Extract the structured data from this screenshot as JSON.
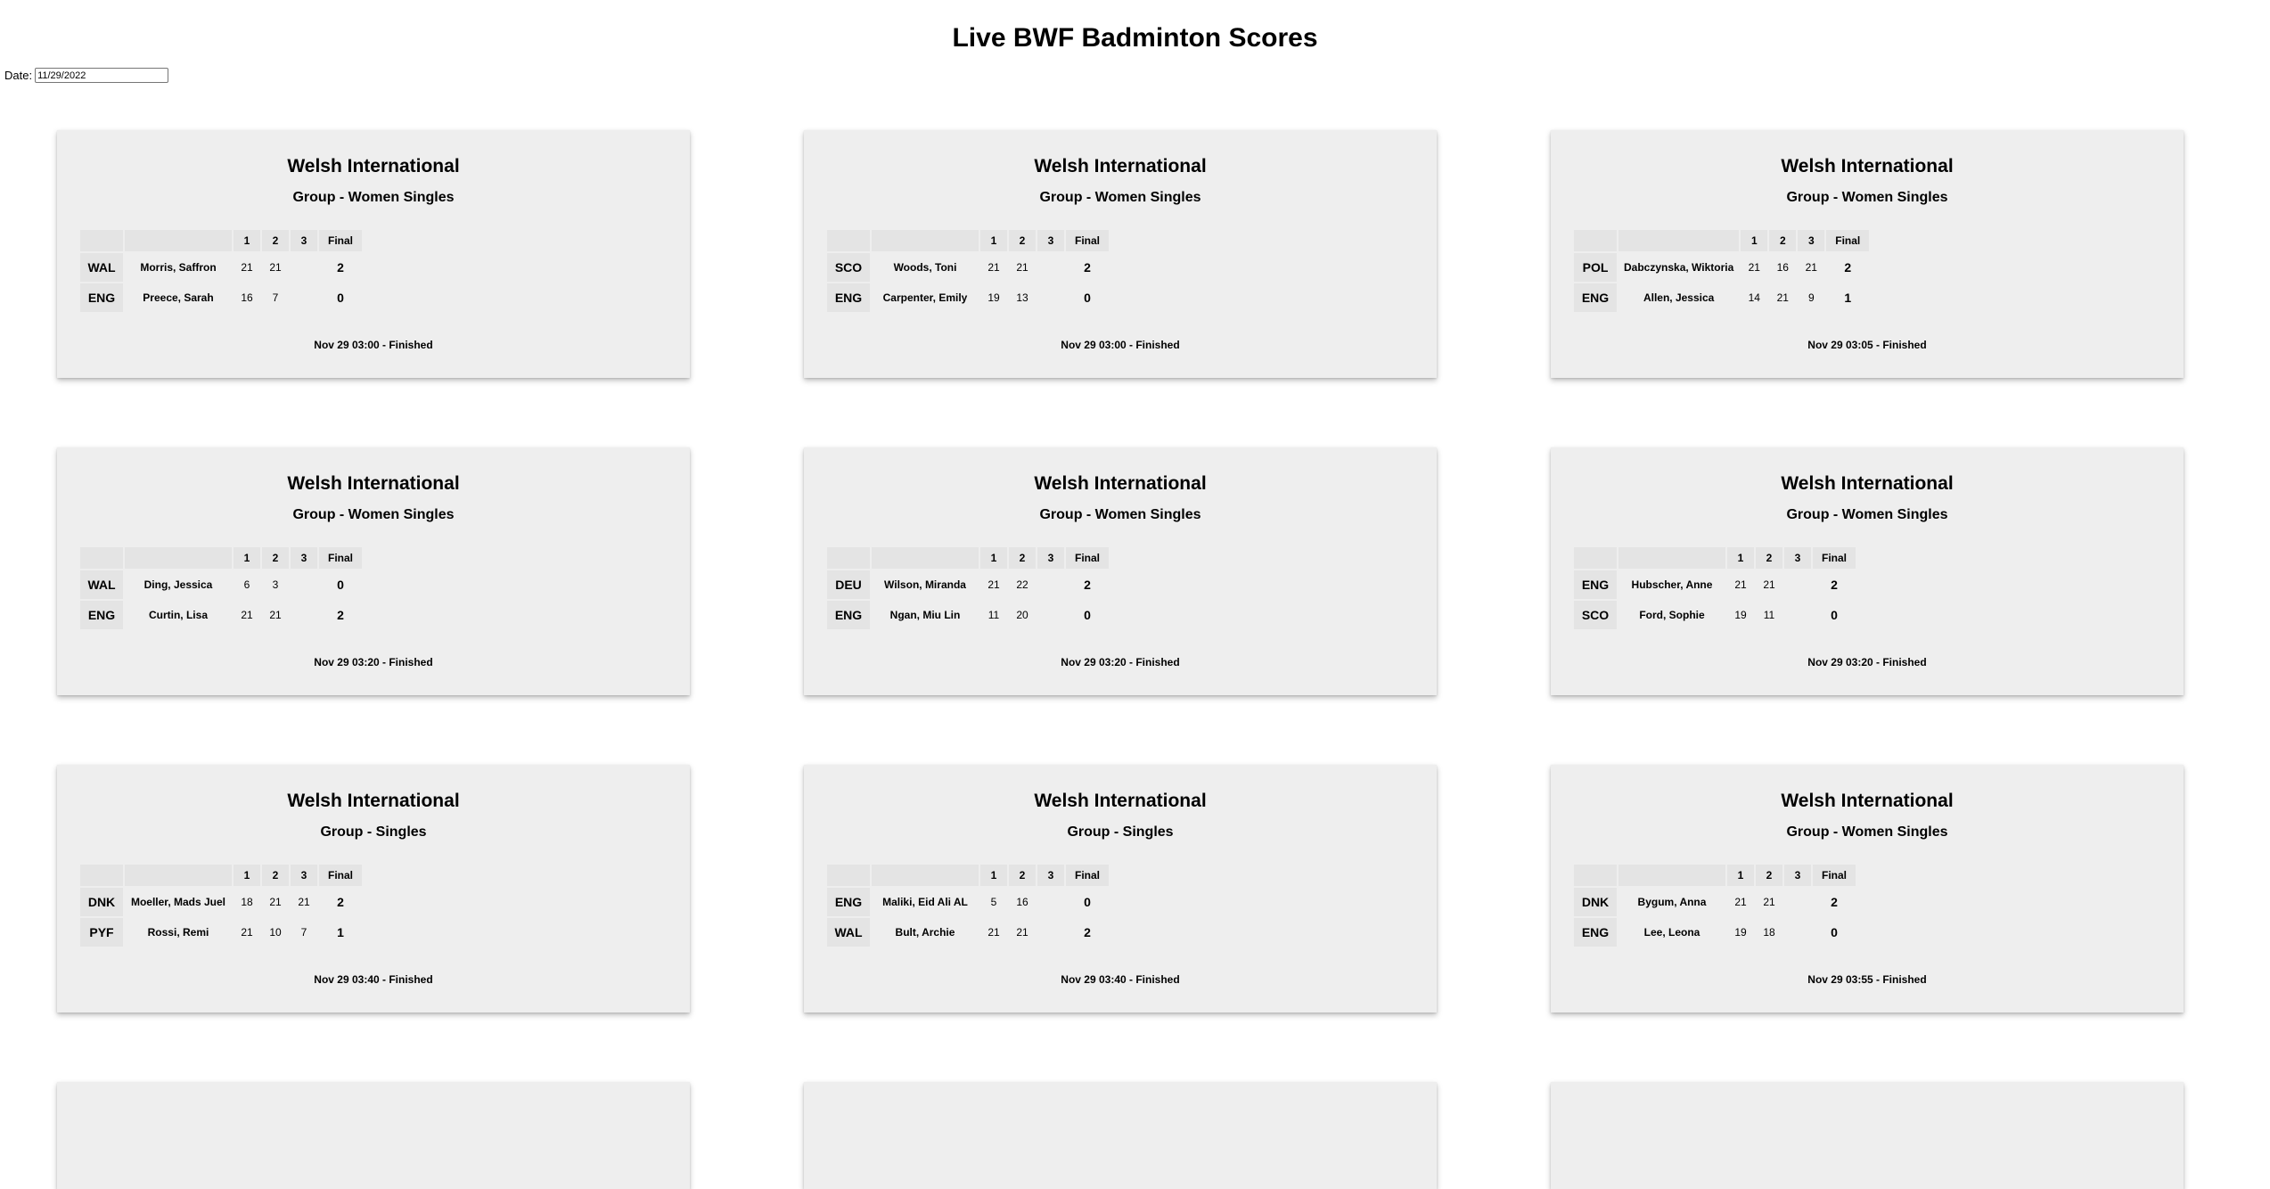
{
  "page": {
    "title": "Live BWF Badminton Scores",
    "date_label": "Date:",
    "date_value": "11/29/2022"
  },
  "table_headers": {
    "g1": "1",
    "g2": "2",
    "g3": "3",
    "final": "Final"
  },
  "matches": [
    {
      "tournament": "Welsh International",
      "round": "Group - Women Singles",
      "players": [
        {
          "country": "WAL",
          "name": "Morris, Saffron",
          "g1": "21",
          "g2": "21",
          "g3": "",
          "final": "2"
        },
        {
          "country": "ENG",
          "name": "Preece, Sarah",
          "g1": "16",
          "g2": "7",
          "g3": "",
          "final": "0"
        }
      ],
      "status": "Nov 29 03:00 - Finished"
    },
    {
      "tournament": "Welsh International",
      "round": "Group - Women Singles",
      "players": [
        {
          "country": "SCO",
          "name": "Woods, Toni",
          "g1": "21",
          "g2": "21",
          "g3": "",
          "final": "2"
        },
        {
          "country": "ENG",
          "name": "Carpenter, Emily",
          "g1": "19",
          "g2": "13",
          "g3": "",
          "final": "0"
        }
      ],
      "status": "Nov 29 03:00 - Finished"
    },
    {
      "tournament": "Welsh International",
      "round": "Group - Women Singles",
      "players": [
        {
          "country": "POL",
          "name": "Dabczynska, Wiktoria",
          "g1": "21",
          "g2": "16",
          "g3": "21",
          "final": "2"
        },
        {
          "country": "ENG",
          "name": "Allen, Jessica",
          "g1": "14",
          "g2": "21",
          "g3": "9",
          "final": "1"
        }
      ],
      "status": "Nov 29 03:05 - Finished"
    },
    {
      "tournament": "Welsh International",
      "round": "Group - Women Singles",
      "players": [
        {
          "country": "WAL",
          "name": "Ding, Jessica",
          "g1": "6",
          "g2": "3",
          "g3": "",
          "final": "0"
        },
        {
          "country": "ENG",
          "name": "Curtin, Lisa",
          "g1": "21",
          "g2": "21",
          "g3": "",
          "final": "2"
        }
      ],
      "status": "Nov 29 03:20 - Finished"
    },
    {
      "tournament": "Welsh International",
      "round": "Group - Women Singles",
      "players": [
        {
          "country": "DEU",
          "name": "Wilson, Miranda",
          "g1": "21",
          "g2": "22",
          "g3": "",
          "final": "2"
        },
        {
          "country": "ENG",
          "name": "Ngan, Miu Lin",
          "g1": "11",
          "g2": "20",
          "g3": "",
          "final": "0"
        }
      ],
      "status": "Nov 29 03:20 - Finished"
    },
    {
      "tournament": "Welsh International",
      "round": "Group - Women Singles",
      "players": [
        {
          "country": "ENG",
          "name": "Hubscher, Anne",
          "g1": "21",
          "g2": "21",
          "g3": "",
          "final": "2"
        },
        {
          "country": "SCO",
          "name": "Ford, Sophie",
          "g1": "19",
          "g2": "11",
          "g3": "",
          "final": "0"
        }
      ],
      "status": "Nov 29 03:20 - Finished"
    },
    {
      "tournament": "Welsh International",
      "round": "Group - Singles",
      "players": [
        {
          "country": "DNK",
          "name": "Moeller, Mads Juel",
          "g1": "18",
          "g2": "21",
          "g3": "21",
          "final": "2"
        },
        {
          "country": "PYF",
          "name": "Rossi, Remi",
          "g1": "21",
          "g2": "10",
          "g3": "7",
          "final": "1"
        }
      ],
      "status": "Nov 29 03:40 - Finished"
    },
    {
      "tournament": "Welsh International",
      "round": "Group - Singles",
      "players": [
        {
          "country": "ENG",
          "name": "Maliki, Eid Ali AL",
          "g1": "5",
          "g2": "16",
          "g3": "",
          "final": "0"
        },
        {
          "country": "WAL",
          "name": "Bult, Archie",
          "g1": "21",
          "g2": "21",
          "g3": "",
          "final": "2"
        }
      ],
      "status": "Nov 29 03:40 - Finished"
    },
    {
      "tournament": "Welsh International",
      "round": "Group - Women Singles",
      "players": [
        {
          "country": "DNK",
          "name": "Bygum, Anna",
          "g1": "21",
          "g2": "21",
          "g3": "",
          "final": "2"
        },
        {
          "country": "ENG",
          "name": "Lee, Leona",
          "g1": "19",
          "g2": "18",
          "g3": "",
          "final": "0"
        }
      ],
      "status": "Nov 29 03:55 - Finished"
    }
  ]
}
